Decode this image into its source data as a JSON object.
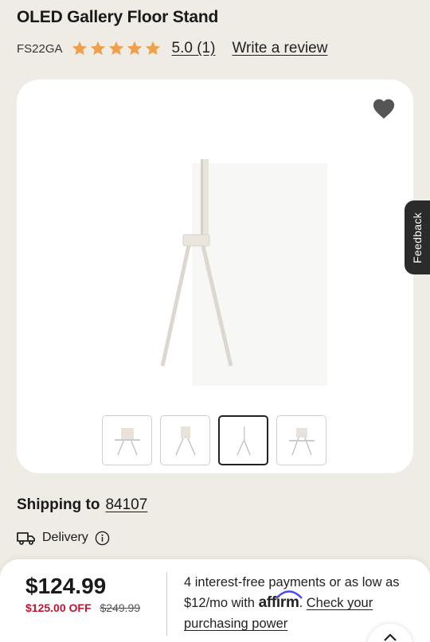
{
  "product": {
    "title": "OLED Gallery Floor Stand",
    "sku": "FS22GA",
    "rating_text": "5.0 (1)",
    "review_link": "Write a review",
    "star_color": "#f0a04b",
    "stars_filled": 5
  },
  "gallery": {
    "favorite_icon": "heart-icon",
    "thumbnails_count": 4,
    "active_thumbnail": 3
  },
  "feedback": {
    "label": "Feedback"
  },
  "shipping": {
    "label": "Shipping to",
    "zip": "84107"
  },
  "delivery": {
    "label": "Delivery",
    "info_icon": "info-icon",
    "truck_icon": "truck-icon"
  },
  "pricing": {
    "price": "$124.99",
    "discount": "$125.00 OFF",
    "original": "$249.99",
    "discount_color": "#c0152f"
  },
  "affirm": {
    "text_before": "4 interest-free payments or as low as $12/mo with",
    "logo_text": "affirm",
    "link": "Check your purchasing power"
  }
}
